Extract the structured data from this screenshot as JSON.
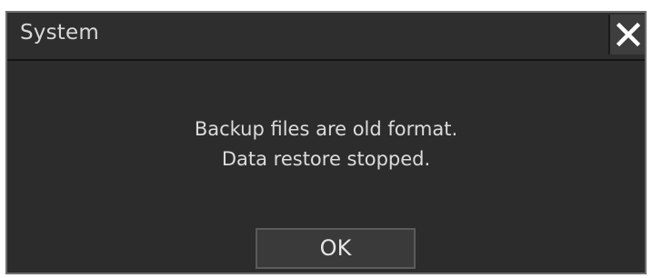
{
  "dialog": {
    "title": "System",
    "close_icon": "close-x-icon",
    "message_lines": [
      "Backup files are old format.",
      "Data restore stopped."
    ],
    "ok_label": "OK"
  },
  "colors": {
    "dialog_background": "#2c2c2c",
    "dialog_border": "#6e6e6e",
    "text": "#dcdcdc",
    "button_background": "#3a3a3a",
    "close_icon": "#ffffff"
  }
}
